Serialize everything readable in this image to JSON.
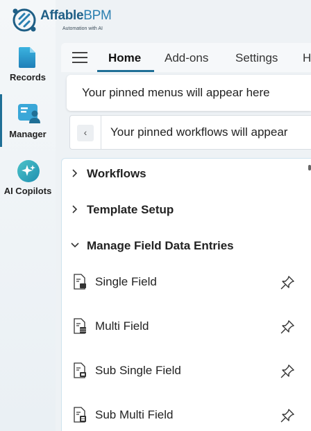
{
  "brand": {
    "name_part1": "Affable",
    "name_part2": "BPM",
    "tagline": "Automation with AI"
  },
  "rail": {
    "items": [
      {
        "label": "Records",
        "icon": "document-icon"
      },
      {
        "label": "Manager",
        "icon": "manager-icon",
        "active": true
      },
      {
        "label": "AI Copilots",
        "icon": "sparkle-icon"
      }
    ]
  },
  "tabs": [
    {
      "label": "Home",
      "active": true
    },
    {
      "label": "Add-ons"
    },
    {
      "label": "Settings"
    },
    {
      "label": "H"
    }
  ],
  "pinned": {
    "menus_text": "Your pinned menus will appear here",
    "workflows_text": "Your pinned workflows will appear",
    "scroll_left_glyph": "‹"
  },
  "menu": {
    "sections": [
      {
        "label": "Workflows",
        "expanded": false
      },
      {
        "label": "Template Setup",
        "expanded": false
      },
      {
        "label": "Manage Field Data Entries",
        "expanded": true
      }
    ],
    "entries": [
      {
        "label": "Single Field",
        "icon": "single-field-icon"
      },
      {
        "label": "Multi Field",
        "icon": "multi-field-icon"
      },
      {
        "label": "Sub Single Field",
        "icon": "sub-single-field-icon"
      },
      {
        "label": "Sub Multi Field",
        "icon": "sub-multi-field-icon"
      }
    ]
  },
  "colors": {
    "accent": "#1f6f96",
    "brand_dark": "#1f5f86",
    "rail_bg": "#eef2f5"
  }
}
